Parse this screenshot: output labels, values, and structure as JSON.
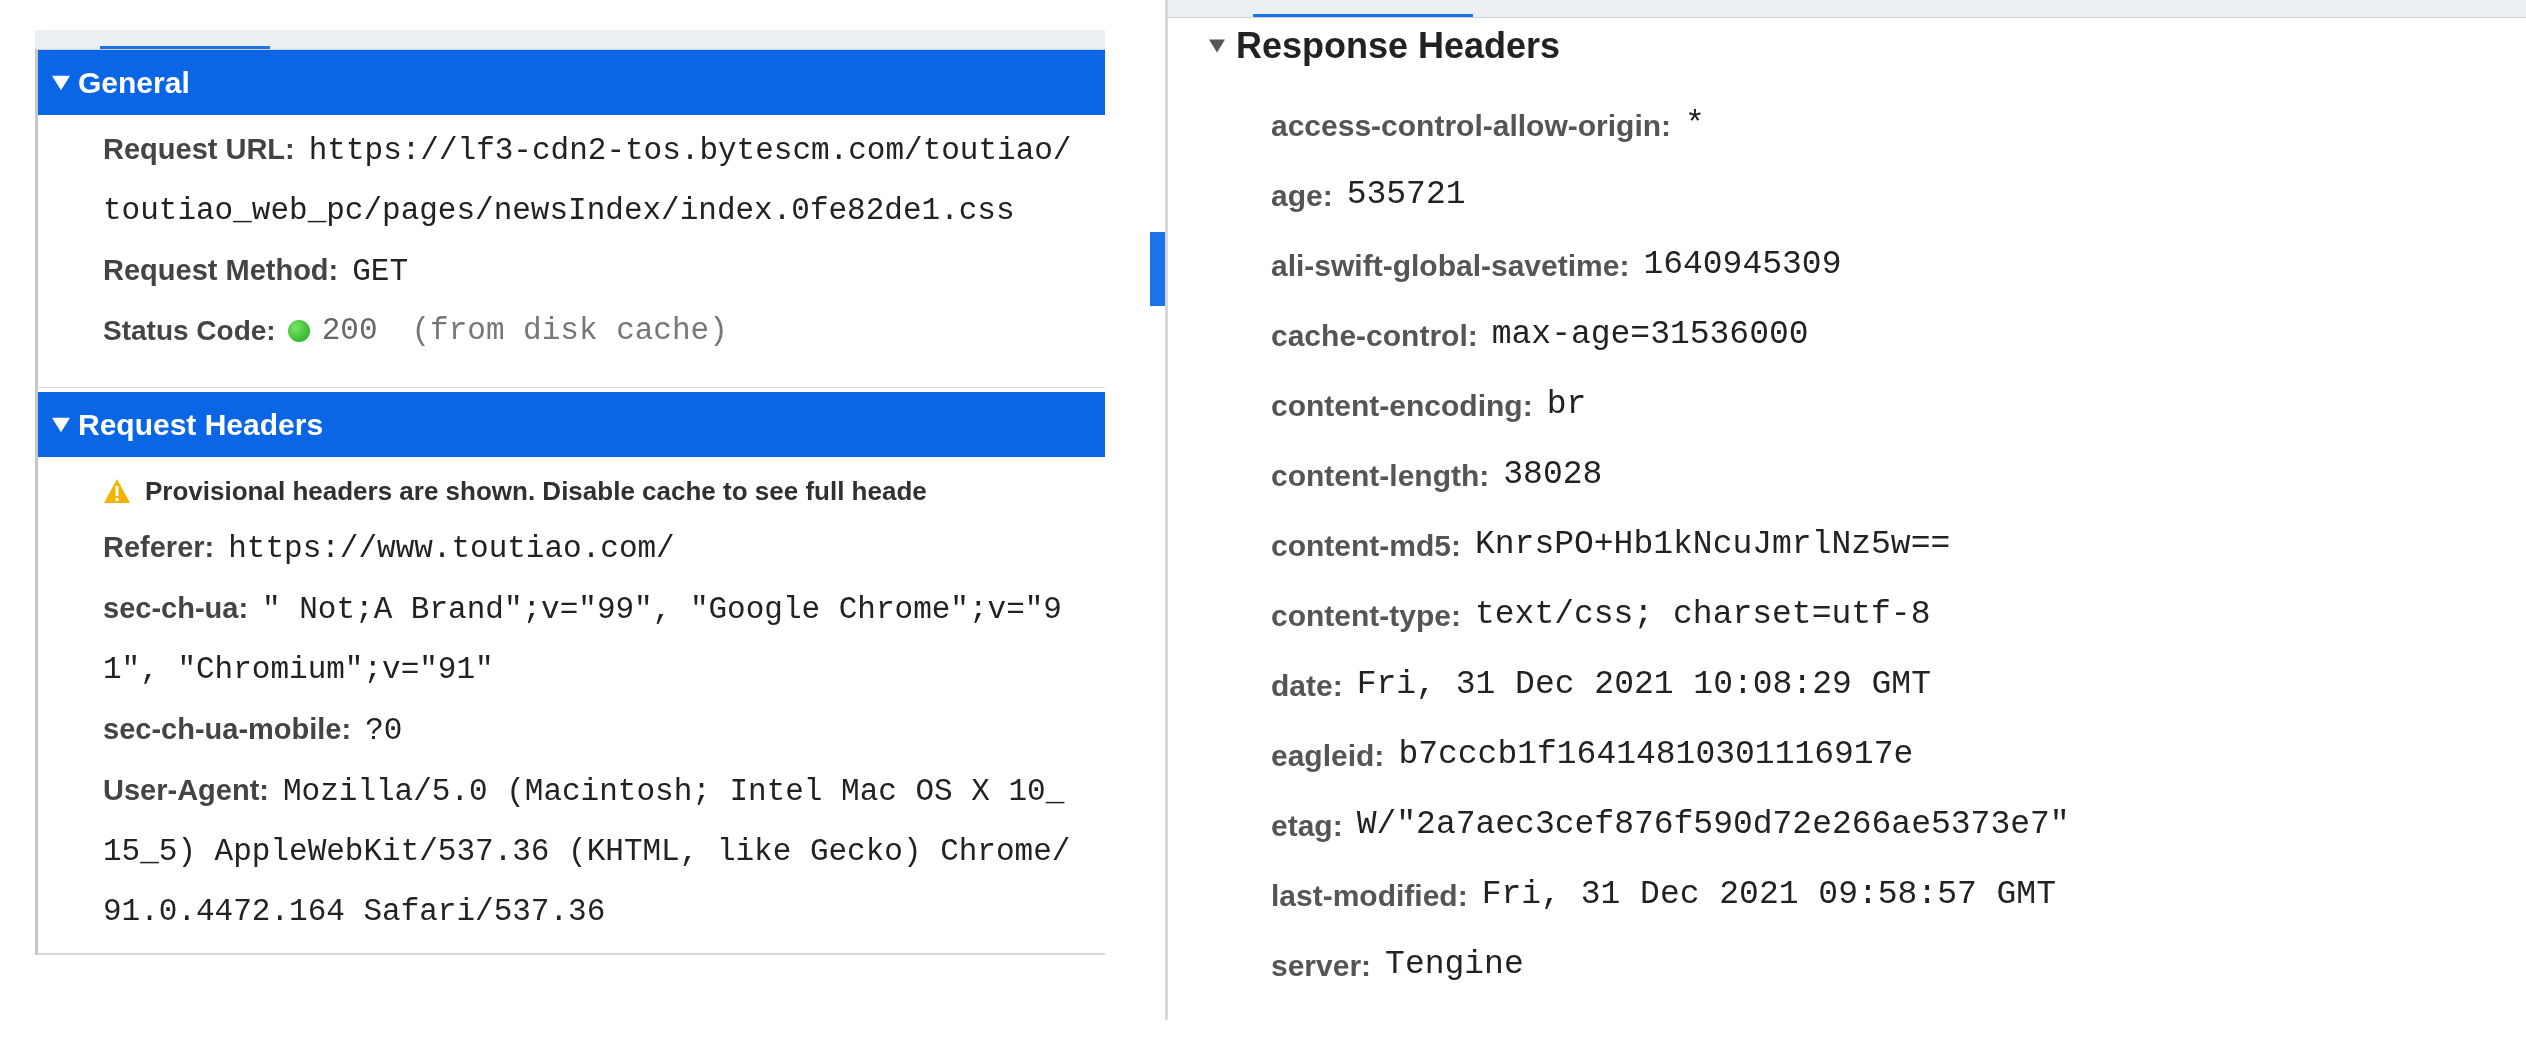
{
  "general": {
    "title": "General",
    "expanded": true,
    "rows": [
      {
        "kind": "field",
        "label": "Request URL:",
        "value": "https://lf3-cdn2-tos.bytescm.com/toutiao/toutiao_web_pc/pages/newsIndex/index.0fe82de1.css"
      },
      {
        "kind": "field",
        "label": "Request Method:",
        "value": "GET"
      },
      {
        "kind": "status",
        "label": "Status Code:",
        "value": "200",
        "note": "(from disk cache)"
      }
    ]
  },
  "request_headers": {
    "title": "Request Headers",
    "expanded": true,
    "rows": [
      {
        "kind": "warning",
        "value": "Provisional headers are shown. Disable cache to see full heade"
      },
      {
        "kind": "field",
        "label": "Referer:",
        "value": "https://www.toutiao.com/"
      },
      {
        "kind": "field",
        "label": "sec-ch-ua:",
        "value": "\" Not;A Brand\";v=\"99\", \"Google Chrome\";v=\"91\", \"Chromium\";v=\"91\""
      },
      {
        "kind": "field",
        "label": "sec-ch-ua-mobile:",
        "value": "?0"
      },
      {
        "kind": "field",
        "label": "User-Agent:",
        "value": "Mozilla/5.0 (Macintosh; Intel Mac OS X 10_15_5) AppleWebKit/537.36 (KHTML, like Gecko) Chrome/91.0.4472.164 Safari/537.36"
      }
    ]
  },
  "response_headers": {
    "title": "Response Headers",
    "expanded": true,
    "rows": [
      {
        "label": "access-control-allow-origin:",
        "value": "*"
      },
      {
        "label": "age:",
        "value": "535721"
      },
      {
        "label": "ali-swift-global-savetime:",
        "value": "1640945309"
      },
      {
        "label": "cache-control:",
        "value": "max-age=31536000"
      },
      {
        "label": "content-encoding:",
        "value": "br"
      },
      {
        "label": "content-length:",
        "value": "38028"
      },
      {
        "label": "content-md5:",
        "value": "KnrsPO+Hb1kNcuJmrlNz5w=="
      },
      {
        "label": "content-type:",
        "value": "text/css; charset=utf-8"
      },
      {
        "label": "date:",
        "value": "Fri, 31 Dec 2021 10:08:29 GMT"
      },
      {
        "label": "eagleid:",
        "value": "b7cccb1f16414810301116917e"
      },
      {
        "label": "etag:",
        "value": "W/\"2a7aec3cef876f590d72e266ae5373e7\""
      },
      {
        "label": "last-modified:",
        "value": "Fri, 31 Dec 2021 09:58:57 GMT"
      },
      {
        "label": "server:",
        "value": "Tengine"
      }
    ]
  }
}
